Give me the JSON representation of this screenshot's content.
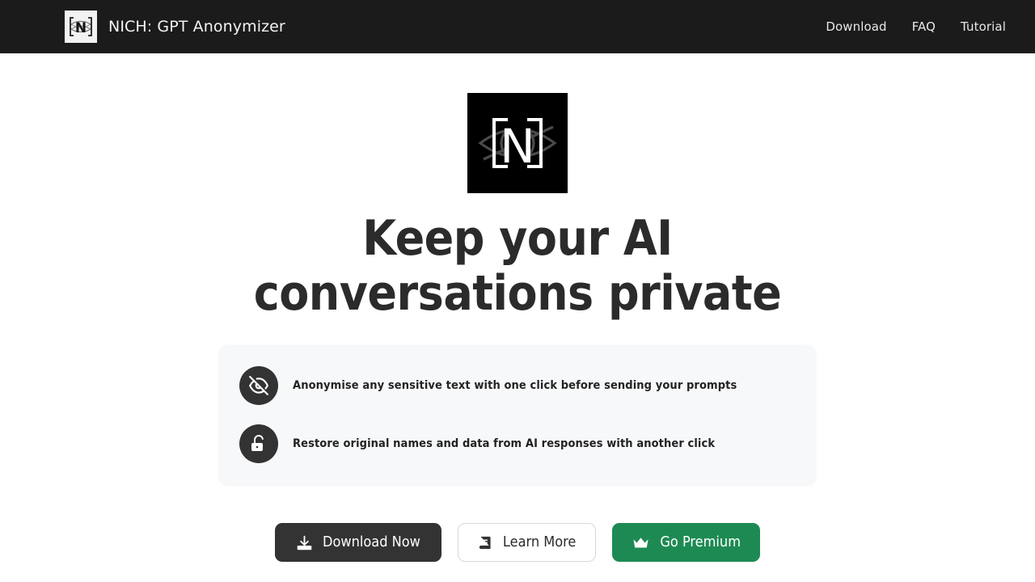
{
  "header": {
    "logo_icon": "nich-bracket-n-logo-icon",
    "title": "NICH: GPT Anonymizer",
    "nav": [
      {
        "label": "Download",
        "name": "nav-link-download"
      },
      {
        "label": "FAQ",
        "name": "nav-link-faq"
      },
      {
        "label": "Tutorial",
        "name": "nav-link-tutorial"
      }
    ],
    "background_color": "#1b1b1b",
    "text_color": "#f4f4f4"
  },
  "hero": {
    "logo_icon": "nich-eye-off-n-logo-icon",
    "logo_background": "#000000",
    "headline": "Keep your AI conversations private"
  },
  "features": {
    "card_background": "#f7f8fa",
    "items": [
      {
        "icon": "eye-off-icon",
        "text": "Anonymise any sensitive text with one click before sending your prompts"
      },
      {
        "icon": "unlock-icon",
        "text": "Restore original names and data from AI responses with another click"
      }
    ]
  },
  "actions": [
    {
      "name": "download-now-button",
      "label": "Download Now",
      "icon": "download-icon",
      "background": "#333333",
      "color": "#ffffff"
    },
    {
      "name": "learn-more-button",
      "label": "Learn More",
      "icon": "book-icon",
      "background": "#ffffff",
      "color": "#2b2b2b"
    },
    {
      "name": "go-premium-button",
      "label": "Go Premium",
      "icon": "crown-icon",
      "background": "#1e8a53",
      "color": "#ffffff"
    }
  ]
}
